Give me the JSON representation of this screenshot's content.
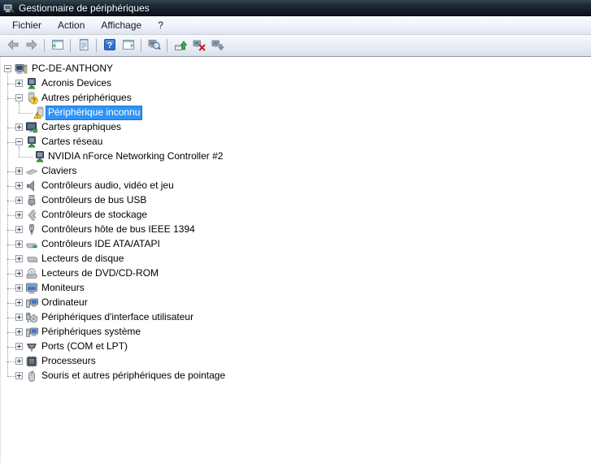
{
  "window": {
    "title": "Gestionnaire de périphériques"
  },
  "colors": {
    "selection_bg": "#2e95f7",
    "selection_border": "#2470c8",
    "titlebar_bg": "#1c2936",
    "toolbar_bg": "#e9edf5"
  },
  "menubar": {
    "items": [
      {
        "id": "fichier",
        "label": "Fichier"
      },
      {
        "id": "action",
        "label": "Action"
      },
      {
        "id": "affichage",
        "label": "Affichage"
      },
      {
        "id": "aide",
        "label": "?"
      }
    ]
  },
  "toolbar": {
    "items": [
      {
        "type": "button",
        "id": "back",
        "icon": "back-arrow",
        "disabled": true
      },
      {
        "type": "button",
        "id": "forward",
        "icon": "forward-arrow",
        "disabled": true
      },
      {
        "type": "separator"
      },
      {
        "type": "button",
        "id": "console-tree",
        "icon": "console-tree"
      },
      {
        "type": "separator"
      },
      {
        "type": "button",
        "id": "properties",
        "icon": "properties"
      },
      {
        "type": "separator"
      },
      {
        "type": "button",
        "id": "help",
        "icon": "help"
      },
      {
        "type": "button",
        "id": "action-pane",
        "icon": "action-pane"
      },
      {
        "type": "separator"
      },
      {
        "type": "button",
        "id": "scan-hardware",
        "icon": "scan-hardware"
      },
      {
        "type": "separator"
      },
      {
        "type": "button",
        "id": "update-driver",
        "icon": "update-driver"
      },
      {
        "type": "button",
        "id": "uninstall",
        "icon": "uninstall-device"
      },
      {
        "type": "button",
        "id": "disable",
        "icon": "disable-device"
      }
    ]
  },
  "tree": {
    "items": [
      {
        "label": "PC-DE-ANTHONY",
        "level": 0,
        "expander": "minus",
        "icon": "computer"
      },
      {
        "label": "Acronis Devices",
        "level": 1,
        "expander": "plus",
        "icon": "network-adapter"
      },
      {
        "label": "Autres périphériques",
        "level": 1,
        "expander": "minus",
        "icon": "unknown-category",
        "child_below": true
      },
      {
        "label": "Périphérique inconnu",
        "level": 2,
        "expander": null,
        "icon": "unknown-device",
        "selected": true
      },
      {
        "label": "Cartes graphiques",
        "level": 1,
        "expander": "plus",
        "icon": "display-adapter"
      },
      {
        "label": "Cartes réseau",
        "level": 1,
        "expander": "minus",
        "icon": "network-adapter",
        "child_below": true
      },
      {
        "label": "NVIDIA nForce Networking Controller #2",
        "level": 2,
        "expander": null,
        "icon": "network-adapter"
      },
      {
        "label": "Claviers",
        "level": 1,
        "expander": "plus",
        "icon": "keyboard"
      },
      {
        "label": "Contrôleurs audio, vidéo et jeu",
        "level": 1,
        "expander": "plus",
        "icon": "audio"
      },
      {
        "label": "Contrôleurs de bus USB",
        "level": 1,
        "expander": "plus",
        "icon": "usb"
      },
      {
        "label": "Contrôleurs de stockage",
        "level": 1,
        "expander": "plus",
        "icon": "storage"
      },
      {
        "label": "Contrôleurs hôte de bus IEEE 1394",
        "level": 1,
        "expander": "plus",
        "icon": "ieee1394"
      },
      {
        "label": "Contrôleurs IDE ATA/ATAPI",
        "level": 1,
        "expander": "plus",
        "icon": "ide-controller"
      },
      {
        "label": "Lecteurs de disque",
        "level": 1,
        "expander": "plus",
        "icon": "disk-drive"
      },
      {
        "label": "Lecteurs de DVD/CD-ROM",
        "level": 1,
        "expander": "plus",
        "icon": "dvd-drive"
      },
      {
        "label": "Moniteurs",
        "level": 1,
        "expander": "plus",
        "icon": "monitor"
      },
      {
        "label": "Ordinateur",
        "level": 1,
        "expander": "plus",
        "icon": "computer-system"
      },
      {
        "label": "Périphériques d'interface utilisateur",
        "level": 1,
        "expander": "plus",
        "icon": "hid-device"
      },
      {
        "label": "Périphériques système",
        "level": 1,
        "expander": "plus",
        "icon": "computer-system"
      },
      {
        "label": "Ports (COM et LPT)",
        "level": 1,
        "expander": "plus",
        "icon": "serial-port"
      },
      {
        "label": "Processeurs",
        "level": 1,
        "expander": "plus",
        "icon": "processor"
      },
      {
        "label": "Souris et autres périphériques de pointage",
        "level": 1,
        "expander": "plus",
        "icon": "mouse"
      }
    ]
  }
}
